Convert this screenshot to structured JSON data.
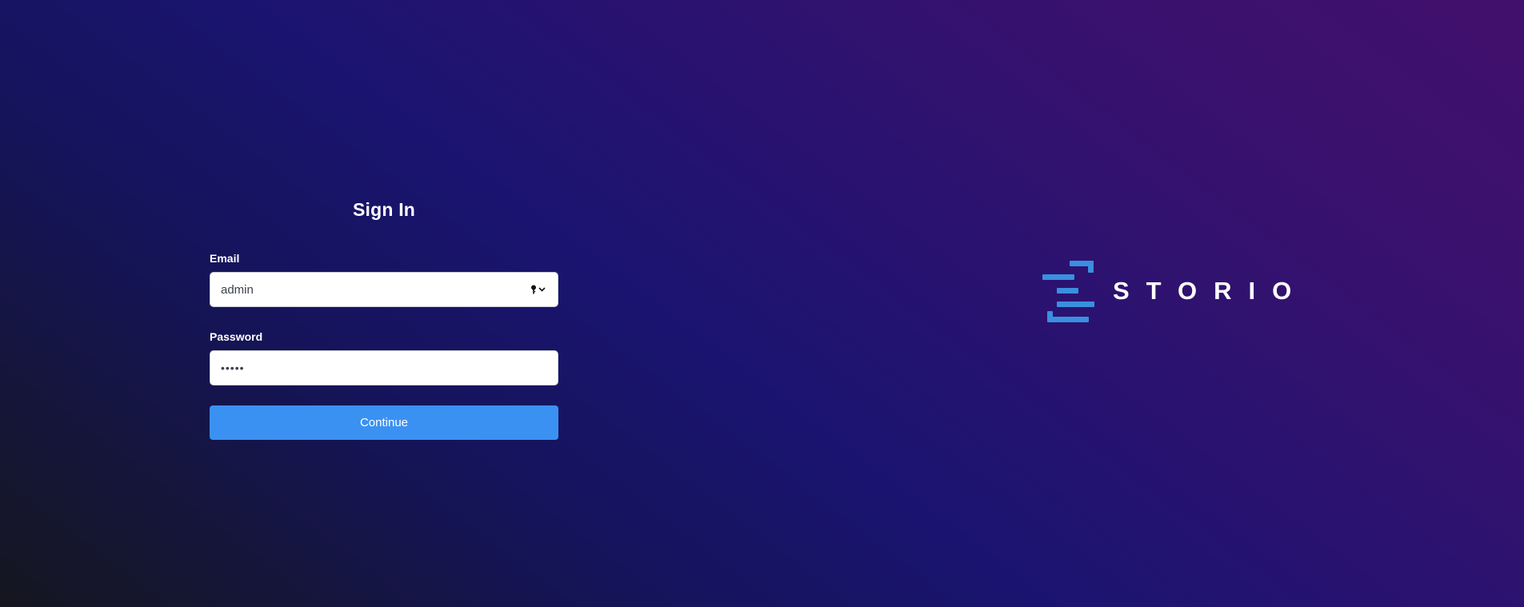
{
  "signin": {
    "title": "Sign In",
    "email_label": "Email",
    "email_value": "admin",
    "password_label": "Password",
    "password_value": "•••••",
    "continue_label": "Continue"
  },
  "brand": {
    "name": "STORIO",
    "mark_color": "#3a8fde",
    "icon": "storio-logo-icon"
  },
  "icons": {
    "autofill": "key-dropdown-icon"
  },
  "colors": {
    "accent": "#3b91f2",
    "background_start": "#15161f",
    "background_mid": "#1a1470",
    "background_end": "#41106c"
  }
}
